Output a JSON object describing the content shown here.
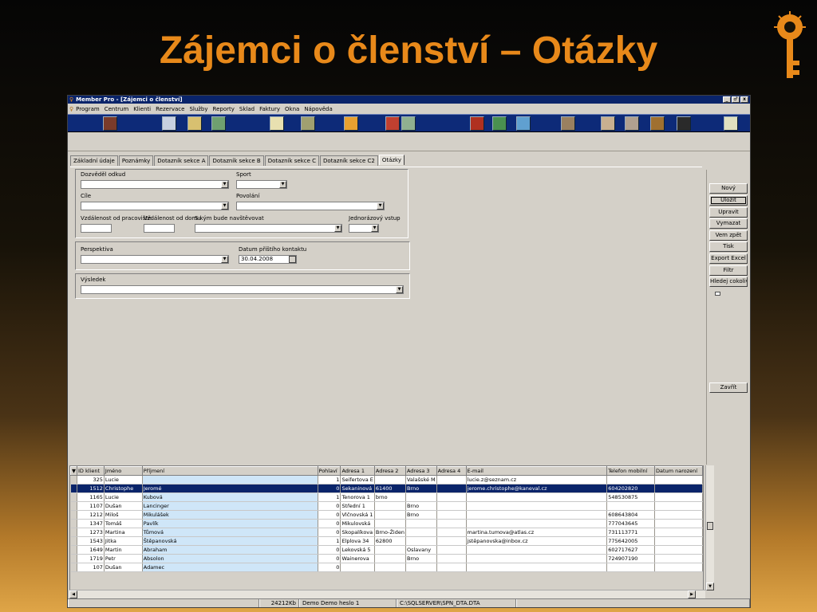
{
  "slide": {
    "title": "Zájemci o členství – Otázky"
  },
  "window": {
    "title": "Member Pro - [Zájemci o členství]",
    "controls": [
      "_",
      "♂",
      "x"
    ]
  },
  "menu": [
    "Program",
    "Centrum",
    "Klienti",
    "Rezervace",
    "Služby",
    "Reporty",
    "Sklad",
    "Faktury",
    "Okna",
    "Nápověda"
  ],
  "toolbar_icons": [
    "client-icon",
    "calendar-icon",
    "notepad-icon",
    "chart-icon",
    "diploma-icon",
    "printer-icon",
    "abc-icon",
    "gift-icon",
    "cards-icon",
    "stop-icon",
    "money-icon",
    "graph-icon",
    "stamp-icon",
    "person-icon",
    "doctor-icon",
    "tools-icon",
    "help-icon",
    "bulb-icon"
  ],
  "tabs": [
    "Základní údaje",
    "Poznámky",
    "Dotazník sekce A",
    "Dotazník sekce B",
    "Dotazník sekce C",
    "Dotazník sekce C2",
    "Otázky"
  ],
  "active_tab": "Otázky",
  "form": {
    "dozvedel": "Dozvěděl odkud",
    "sport": "Sport",
    "cile": "Cíle",
    "povolani": "Povolání",
    "vzd_prac": "Vzdálenost od pracoviště",
    "vzd_domu": "Vzdálenost od domu",
    "s_kym": "S kým bude navštěvovat",
    "jednorazovy": "Jednorázový vstup",
    "perspektiva": "Perspektiva",
    "datum_label": "Datum příštího kontaktu",
    "datum_value": "30.04.2008",
    "vysledek": "Výsledek"
  },
  "buttons": {
    "novy": "Nový",
    "ulozit": "Uložit",
    "upravit": "Upravit",
    "vymazat": "Vymazat",
    "vem_zpet": "Vem zpět",
    "tisk": "Tisk",
    "export": "Export Excel",
    "filtr": "Filtr",
    "hledej": "Hledej cokoliv",
    "zavrit": "Zavřít"
  },
  "grid": {
    "columns": [
      "ID klient",
      "Jméno",
      "Příjmení",
      "Pohlaví",
      "Adresa 1",
      "Adresa 2",
      "Adresa 3",
      "Adresa 4",
      "E-mail",
      "Telefon mobilní",
      "Datum narození"
    ],
    "rows": [
      [
        "325",
        "Lucie",
        "",
        "1",
        "Seifertova E",
        "",
        "Valašské M",
        "",
        "lucie.z@seznam.cz",
        "",
        ""
      ],
      [
        "1512",
        "Christophe",
        "Jeromé",
        "0",
        "Sekaninová",
        "61400",
        "Brno",
        "",
        "jerome.christophe@kaneval.cz",
        "604202820",
        ""
      ],
      [
        "1165",
        "Lucie",
        "Kubová",
        "1",
        "Tenorova 1",
        "brno",
        "",
        "",
        "",
        "548530875",
        ""
      ],
      [
        "1107",
        "Dušan",
        "Lancinger",
        "0",
        "Střední 1",
        "",
        "Brno",
        "",
        "",
        "",
        ""
      ],
      [
        "1212",
        "Miloš",
        "Mikulášek",
        "0",
        "Vlčnovská 1",
        "",
        "Brno",
        "",
        "",
        "608643804",
        ""
      ],
      [
        "1347",
        "Tomáš",
        "Pavlík",
        "0",
        "Mikulovská",
        "",
        "",
        "",
        "",
        "777043645",
        ""
      ],
      [
        "1273",
        "Martina",
        "Tůmová",
        "0",
        "Skopalíkova",
        "Brno-Židen",
        "",
        "",
        "martina.tumova@atlas.cz",
        "731113771",
        ""
      ],
      [
        "1543",
        "Jitka",
        "Štěpanovská",
        "1",
        "Elplova 34",
        "62800",
        "",
        "",
        "jstěpanovska@inbox.cz",
        "775642005",
        ""
      ],
      [
        "1649",
        "Martin",
        "Abraham",
        "0",
        "Lekovská 5",
        "",
        "Oslavany",
        "",
        "",
        "602717627",
        ""
      ],
      [
        "1719",
        "Petr",
        "Absolon",
        "0",
        "Wainerova",
        "",
        "Brno",
        "",
        "",
        "724907190",
        ""
      ],
      [
        "107",
        "Dušan",
        "Adamec",
        "0",
        "",
        "",
        "",
        "",
        "",
        "",
        ""
      ]
    ]
  },
  "status": {
    "memory": "24212Kb",
    "user": "Demo Demo heslo 1",
    "path": "C:\\SQLSERVER\\SPN_DTA.DTA"
  },
  "colors": {
    "titlebar": "#0a246a",
    "toolbar": "#0d2a78",
    "accent": "#e8891a",
    "selection": "#0a246a"
  }
}
